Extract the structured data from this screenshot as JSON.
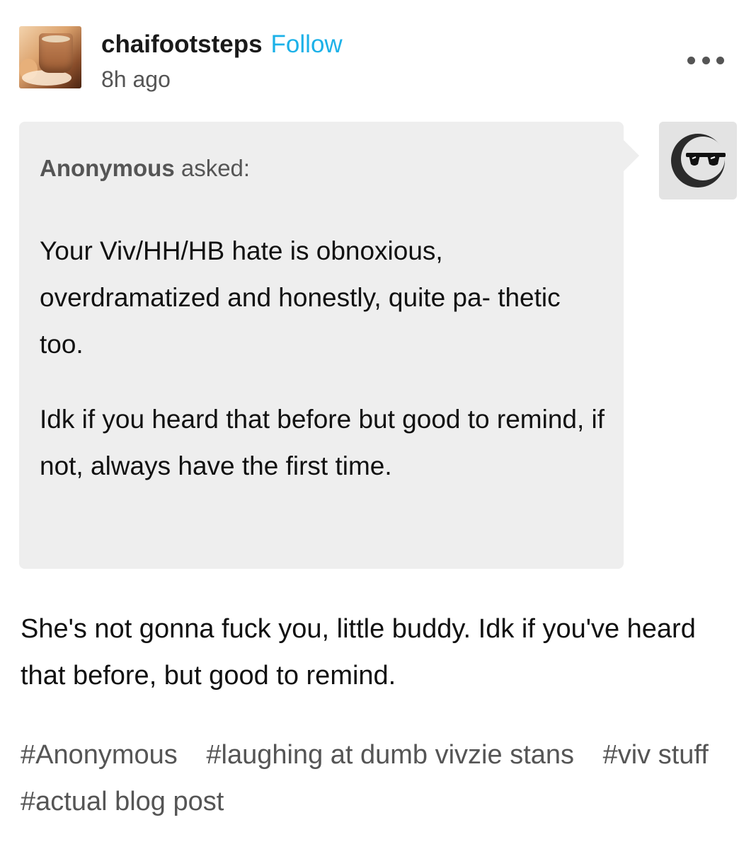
{
  "post": {
    "username": "chaifootsteps",
    "follow_label": "Follow",
    "timestamp": "8h ago",
    "avatar_icon": "chai-cup-avatar",
    "more_icon": "more-dots-icon"
  },
  "ask": {
    "asker": "Anonymous",
    "asked_label": " asked:",
    "avatar_icon": "anonymous-sunglasses-avatar",
    "paragraphs": [
      "Your Viv/HH/HB hate is obnoxious, overdramatized and honestly, quite pa- thetic too.",
      "Idk if you heard that before but good to remind, if not, always have the first time."
    ]
  },
  "answer": {
    "text": "She's not gonna fuck you, little buddy. Idk if you've heard that before, but good to remind."
  },
  "tags": [
    "#Anonymous",
    "#laughing at dumb vivzie stans",
    "#viv stuff",
    "#actual blog post"
  ],
  "colors": {
    "follow": "#1cb1e8",
    "ask_background": "#eeeeee",
    "muted_text": "#555555"
  }
}
